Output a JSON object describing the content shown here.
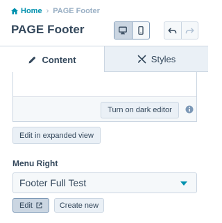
{
  "breadcrumb": {
    "home_label": "Home",
    "separator": "›",
    "current_label": "PAGE Footer"
  },
  "header": {
    "title": "PAGE Footer"
  },
  "tabs": [
    {
      "label": "Content",
      "icon": "pencil-icon",
      "active": true
    },
    {
      "label": "Styles",
      "icon": "brush-icon",
      "active": false
    }
  ],
  "editor": {
    "dark_editor_label": "Turn on dark editor",
    "expanded_view_label": "Edit in expanded view"
  },
  "menu_right": {
    "label": "Menu Right",
    "selected_value": "Footer Full Test",
    "edit_label": "Edit",
    "create_label": "Create new"
  },
  "colors": {
    "accent": "#0091ae",
    "text": "#33475b",
    "border": "#cbd6e2"
  }
}
